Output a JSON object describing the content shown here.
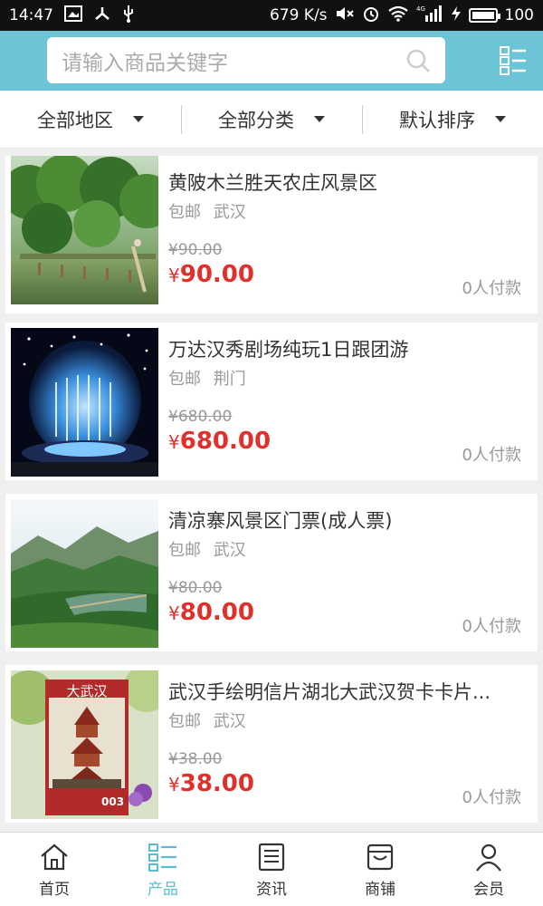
{
  "status_bar": {
    "time": "14:47",
    "speed": "679 K/s",
    "battery": "100"
  },
  "search": {
    "placeholder": "请输入商品关键字"
  },
  "filters": [
    {
      "label": "全部地区"
    },
    {
      "label": "全部分类"
    },
    {
      "label": "默认排序"
    }
  ],
  "products": [
    {
      "title": "黄陂木兰胜天农庄风景区",
      "shipping": "包邮",
      "city": "武汉",
      "old_price": "¥90.00",
      "price_symbol": "¥",
      "price": "90.00",
      "paid": "0人付款"
    },
    {
      "title": "万达汉秀剧场纯玩1日跟团游",
      "shipping": "包邮",
      "city": "荆门",
      "old_price": "¥680.00",
      "price_symbol": "¥",
      "price": "680.00",
      "paid": "0人付款"
    },
    {
      "title": "清凉寨风景区门票(成人票)",
      "shipping": "包邮",
      "city": "武汉",
      "old_price": "¥80.00",
      "price_symbol": "¥",
      "price": "80.00",
      "paid": "0人付款"
    },
    {
      "title": "武汉手绘明信片湖北大武汉贺卡卡片...",
      "shipping": "包邮",
      "city": "武汉",
      "old_price": "¥38.00",
      "price_symbol": "¥",
      "price": "38.00",
      "paid": "0人付款"
    }
  ],
  "postcard": {
    "title_text": "大武汉",
    "number": "003"
  },
  "tabbar": [
    {
      "label": "首页",
      "icon": "home-icon"
    },
    {
      "label": "产品",
      "icon": "product-list-icon",
      "active": true
    },
    {
      "label": "资讯",
      "icon": "news-icon"
    },
    {
      "label": "商铺",
      "icon": "shop-icon"
    },
    {
      "label": "会员",
      "icon": "member-icon"
    }
  ],
  "colors": {
    "header": "#6cc4d6",
    "price": "#e0302b",
    "tab_active": "#5bbcd3"
  }
}
